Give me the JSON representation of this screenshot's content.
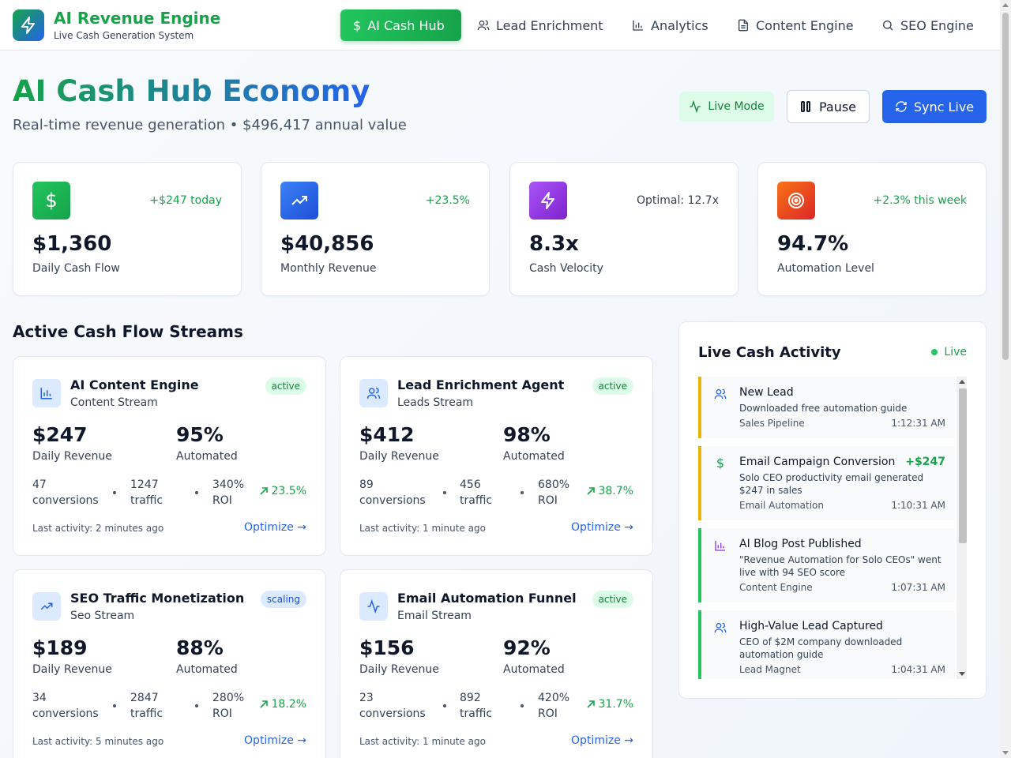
{
  "brand": {
    "title": "AI Revenue Engine",
    "subtitle": "Live Cash Generation System",
    "logo_icon": "bolt-icon"
  },
  "nav": [
    {
      "label": "AI Cash Hub",
      "icon": "dollar-icon",
      "active": true
    },
    {
      "label": "Lead Enrichment",
      "icon": "users-icon"
    },
    {
      "label": "Analytics",
      "icon": "bar-chart-icon"
    },
    {
      "label": "Content Engine",
      "icon": "document-icon"
    },
    {
      "label": "SEO Engine",
      "icon": "search-icon"
    }
  ],
  "header": {
    "title": "AI Cash Hub Economy",
    "subtitle": "Real-time revenue generation • $496,417 annual value",
    "live_mode": "Live Mode",
    "pause": "Pause",
    "sync": "Sync Live"
  },
  "stats": [
    {
      "value": "$1,360",
      "label": "Daily Cash Flow",
      "delta": "+$247 today",
      "icon": "dollar-icon",
      "color": "#16a34a"
    },
    {
      "value": "$40,856",
      "label": "Monthly Revenue",
      "delta": "+23.5%",
      "icon": "trending-up-icon",
      "color": "#2563eb"
    },
    {
      "value": "8.3x",
      "label": "Cash Velocity",
      "delta": "Optimal: 12.7x",
      "icon": "bolt-icon",
      "color": "#9333ea"
    },
    {
      "value": "94.7%",
      "label": "Automation Level",
      "delta": "+2.3% this week",
      "icon": "target-icon",
      "color": "#ea580c"
    }
  ],
  "streams_title": "Active Cash Flow Streams",
  "streams": [
    {
      "name": "AI Content Engine",
      "type": "Content Stream",
      "status": "active",
      "revenue": "$247",
      "revenue_label": "Daily Revenue",
      "automated": "95%",
      "automated_label": "Automated",
      "conversions": "47",
      "conversions_label": "conversions",
      "traffic": "1247",
      "traffic_label": "traffic",
      "roi": "340%",
      "roi_label": "ROI",
      "growth": "23.5%",
      "last": "Last activity: 2 minutes ago",
      "optimize": "Optimize →",
      "icon": "bar-chart-icon"
    },
    {
      "name": "Lead Enrichment Agent",
      "type": "Leads Stream",
      "status": "active",
      "revenue": "$412",
      "revenue_label": "Daily Revenue",
      "automated": "98%",
      "automated_label": "Automated",
      "conversions": "89",
      "conversions_label": "conversions",
      "traffic": "456",
      "traffic_label": "traffic",
      "roi": "680%",
      "roi_label": "ROI",
      "growth": "38.7%",
      "last": "Last activity: 1 minute ago",
      "optimize": "Optimize →",
      "icon": "users-icon"
    },
    {
      "name": "SEO Traffic Monetization",
      "type": "Seo Stream",
      "status": "scaling",
      "revenue": "$189",
      "revenue_label": "Daily Revenue",
      "automated": "88%",
      "automated_label": "Automated",
      "conversions": "34",
      "conversions_label": "conversions",
      "traffic": "2847",
      "traffic_label": "traffic",
      "roi": "280%",
      "roi_label": "ROI",
      "growth": "18.2%",
      "last": "Last activity: 5 minutes ago",
      "optimize": "Optimize →",
      "icon": "trending-up-icon"
    },
    {
      "name": "Email Automation Funnel",
      "type": "Email Stream",
      "status": "active",
      "revenue": "$156",
      "revenue_label": "Daily Revenue",
      "automated": "92%",
      "automated_label": "Automated",
      "conversions": "23",
      "conversions_label": "conversions",
      "traffic": "892",
      "traffic_label": "traffic",
      "roi": "420%",
      "roi_label": "ROI",
      "growth": "31.7%",
      "last": "Last activity: 1 minute ago",
      "optimize": "Optimize →",
      "icon": "activity-icon"
    }
  ],
  "activity": {
    "title": "Live Cash Activity",
    "live": "Live",
    "items": [
      {
        "title": "New Lead",
        "amount": "",
        "desc": "Downloaded free automation guide",
        "source": "Sales Pipeline",
        "time": "1:12:31 AM",
        "icon": "users-icon",
        "accent": "#eab308",
        "icon_color": "#2563eb"
      },
      {
        "title": "Email Campaign Conversion",
        "amount": "+$247",
        "desc": "Solo CEO productivity email generated $247 in sales",
        "source": "Email Automation",
        "time": "1:10:31 AM",
        "icon": "dollar-icon",
        "accent": "#eab308",
        "icon_color": "#16a34a"
      },
      {
        "title": "AI Blog Post Published",
        "amount": "",
        "desc": "\"Revenue Automation for Solo CEOs\" went live with 94 SEO score",
        "source": "Content Engine",
        "time": "1:07:31 AM",
        "icon": "bar-chart-icon",
        "accent": "#22c55e",
        "icon_color": "#9333ea"
      },
      {
        "title": "High-Value Lead Captured",
        "amount": "",
        "desc": "CEO of $2M company downloaded automation guide",
        "source": "Lead Magnet",
        "time": "1:04:31 AM",
        "icon": "users-icon",
        "accent": "#22c55e",
        "icon_color": "#2563eb"
      }
    ]
  }
}
